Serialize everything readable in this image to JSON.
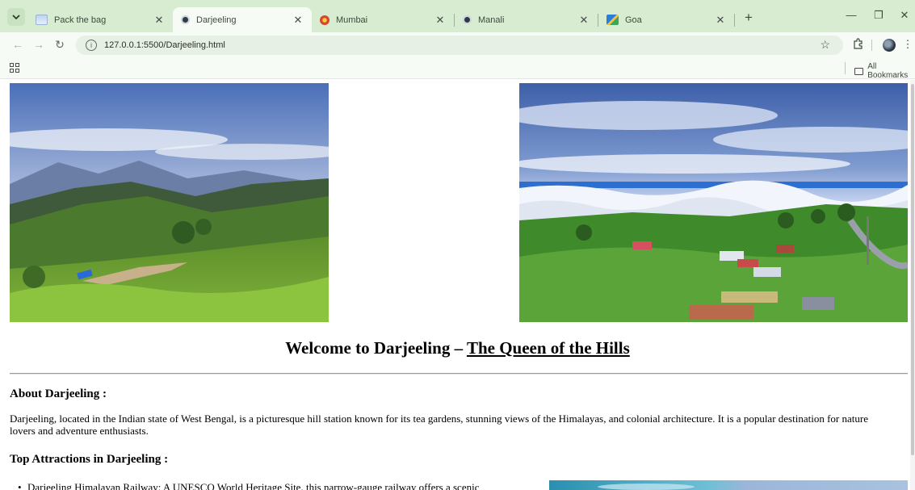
{
  "browser": {
    "tabs": [
      {
        "title": "Pack the bag",
        "favicon": "cloud-icon",
        "active": false
      },
      {
        "title": "Darjeeling",
        "favicon": "globe-icon",
        "active": true
      },
      {
        "title": "Mumbai",
        "favicon": "flower-icon",
        "active": false
      },
      {
        "title": "Manali",
        "favicon": "globe-icon",
        "active": false
      },
      {
        "title": "Goa",
        "favicon": "image-icon",
        "active": false
      }
    ],
    "url": "127.0.0.1:5500/Darjeeling.html",
    "bookmarks_label": "All Bookmarks",
    "colors": {
      "frame": "#d8ecd2",
      "toolbar": "#f7fbf5",
      "omnibox": "#e7f0e4"
    }
  },
  "page": {
    "title_main": "Welcome to Darjeeling – ",
    "title_sub": "The Queen of the Hills",
    "about_heading": "About Darjeeling :",
    "about_text": "Darjeeling, located in the Indian state of West Bengal, is a picturesque hill station known for its tea gardens, stunning views of the Himalayas, and colonial architecture. It is a popular destination for nature lovers and adventure enthusiasts.",
    "attractions_heading": "Top Attractions in Darjeeling :",
    "attractions": [
      "Darjeeling Himalayan Railway: A UNESCO World Heritage Site, this narrow-gauge railway offers a scenic"
    ]
  }
}
